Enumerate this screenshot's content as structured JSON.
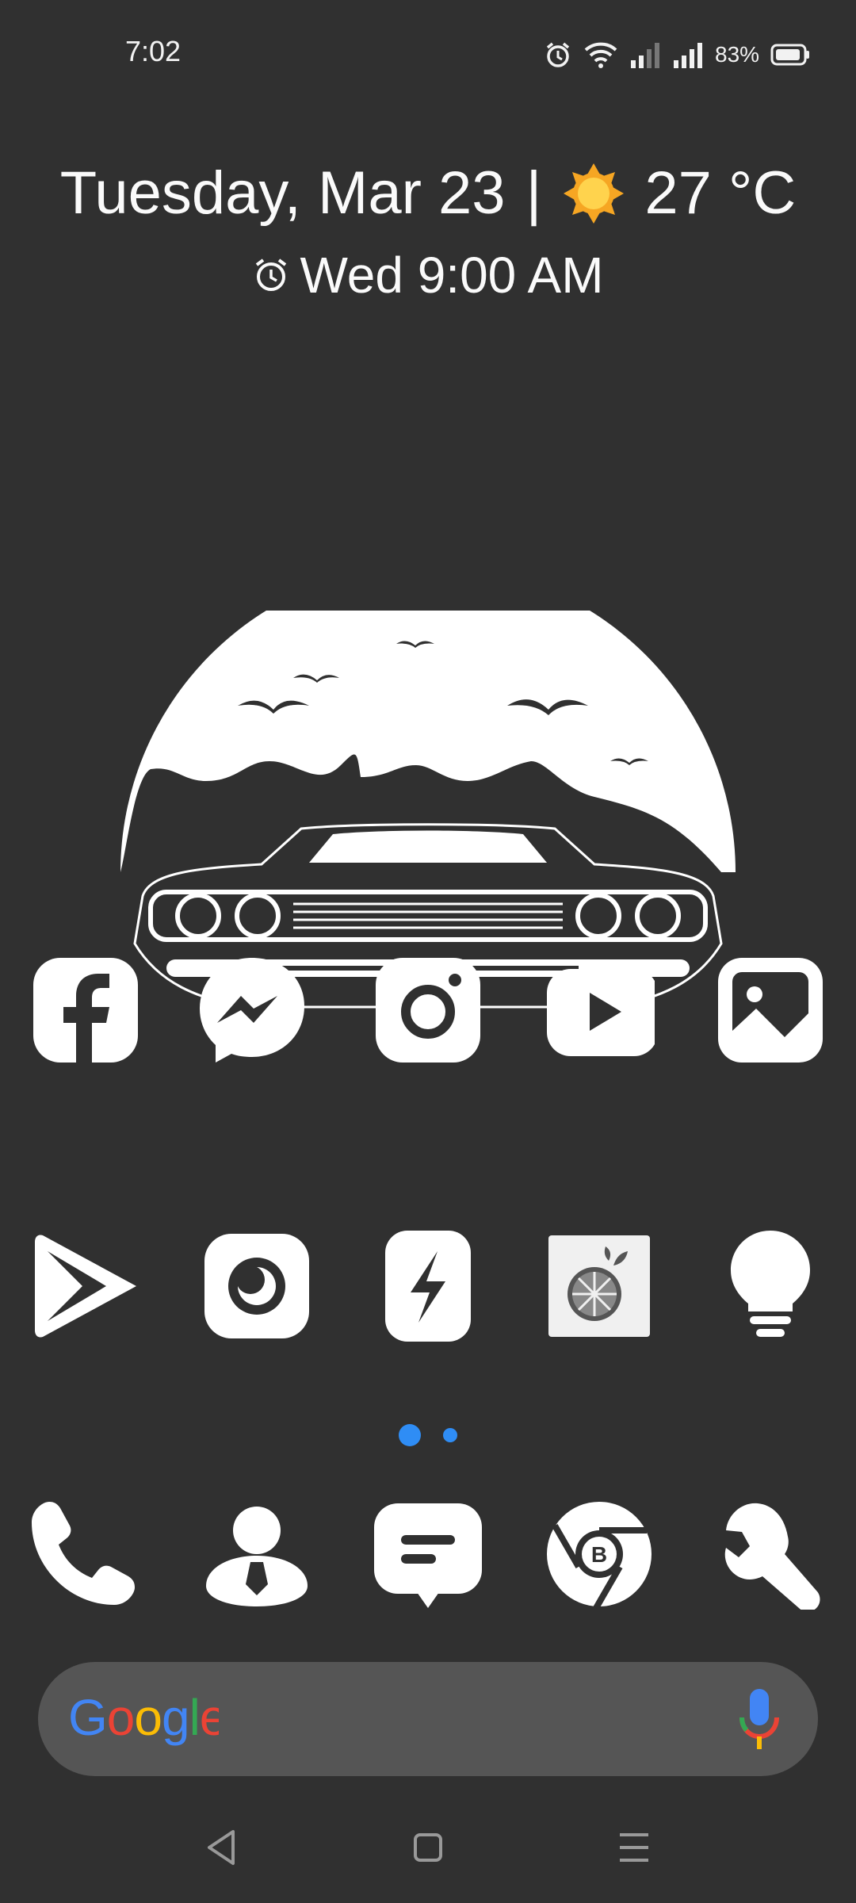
{
  "status_bar": {
    "time": "7:02",
    "battery": "83%",
    "icons": [
      "alarm-icon",
      "wifi-icon",
      "signal-icon",
      "signal-icon",
      "battery-icon"
    ]
  },
  "widget": {
    "date": "Tuesday, Mar 23",
    "separator": "|",
    "weather_icon": "sun-icon",
    "temperature": "27 °C",
    "alarm_icon": "alarm-clock-icon",
    "next_alarm": "Wed 9:00 AM"
  },
  "wallpaper": "car-moon-birds-silhouette",
  "home_row1": [
    "facebook-icon",
    "messenger-icon",
    "instagram-icon",
    "youtube-icon",
    "gallery-icon"
  ],
  "home_row2": [
    "play-store-icon",
    "camera-icon",
    "flash-icon",
    "lemon-app-icon",
    "bulb-icon"
  ],
  "page_indicator": {
    "pages": 2,
    "active": 1
  },
  "dock": [
    "phone-icon",
    "contacts-icon",
    "messages-icon",
    "chrome-icon",
    "tools-icon"
  ],
  "search_bar": {
    "logo": "Google",
    "mic_icon": "microphone-icon"
  },
  "colors": {
    "background": "#303030",
    "accent": "#2f8df5",
    "search_bg": "#555555",
    "google_blue": "#4285F4",
    "google_red": "#EA4335",
    "google_yellow": "#FBBC05",
    "google_green": "#34A853"
  },
  "nav_bar": [
    "back-icon",
    "home-icon",
    "recents-icon"
  ]
}
